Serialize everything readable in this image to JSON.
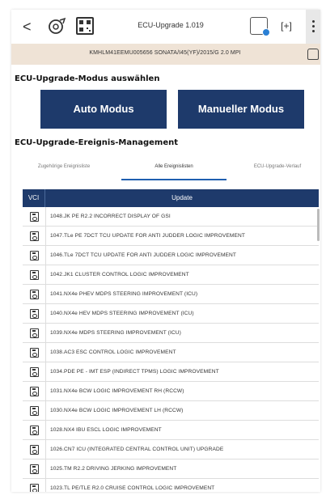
{
  "titlebar": {
    "back": "<",
    "title": "ECU-Upgrade 1.019",
    "expand": "[+]"
  },
  "vehicle": {
    "info": "KMHLM41EEMU005656  SONATA/I45(YF)/2015/G 2.0 MPI"
  },
  "mode_section": {
    "title": "ECU-Upgrade-Modus auswählen",
    "auto_label": "Auto Modus",
    "manual_label": "Manueller Modus"
  },
  "event_section": {
    "title": "ECU-Upgrade-Ereignis-Management"
  },
  "tabs": [
    {
      "label": "Zugehörige Ereignisliste",
      "active": false
    },
    {
      "label": "Alle Ereignislisten",
      "active": true
    },
    {
      "label": "ECU-Upgrade-Verlauf",
      "active": false
    }
  ],
  "table": {
    "col_vci": "VCI",
    "col_update": "Update",
    "rows": [
      "1048.JK PE R2.2 INCORRECT DISPLAY OF GSI",
      "1047.TLe PE 7DCT TCU UPDATE FOR ANTI JUDDER LOGIC IMPROVEMENT",
      "1046.TLe 7DCT TCU UPDATE FOR ANTI JUDDER LOGIC IMPROVEMENT",
      "1042.JK1 CLUSTER CONTROL LOGIC IMPROVEMENT",
      "1041.NX4e PHEV MDPS STEERING IMPROVEMENT (ICU)",
      "1040.NX4e HEV MDPS STEERING IMPROVEMENT (ICU)",
      "1039.NX4e MDPS STEERING IMPROVEMENT (ICU)",
      "1038.AC3 ESC CONTROL LOGIC IMPROVEMENT",
      "1034.PDE PE - IMT ESP (INDIRECT TPMS) LOGIC IMPROVEMENT",
      "1031.NX4e BCW LOGIC IMPROVEMENT RH (RCCW)",
      "1030.NX4e BCW LOGIC IMPROVEMENT LH (RCCW)",
      "1028.NX4 IBU ESCL LOGIC IMPROVEMENT",
      "1026.CN7 ICU (INTEGRATED CENTRAL CONTROL UNIT) UPGRADE",
      "1025.TM R2.2 DRIVING JERKING IMPROVEMENT",
      "1023.TL PE/TLE R2.0 CRUISE CONTROL LOGIC IMPROVEMENT"
    ]
  },
  "colors": {
    "primary": "#1e3a6b",
    "vin_bar": "#efe3d6",
    "tab_active": "#1f5fb0",
    "ecu_badge": "#2a7fd4"
  }
}
